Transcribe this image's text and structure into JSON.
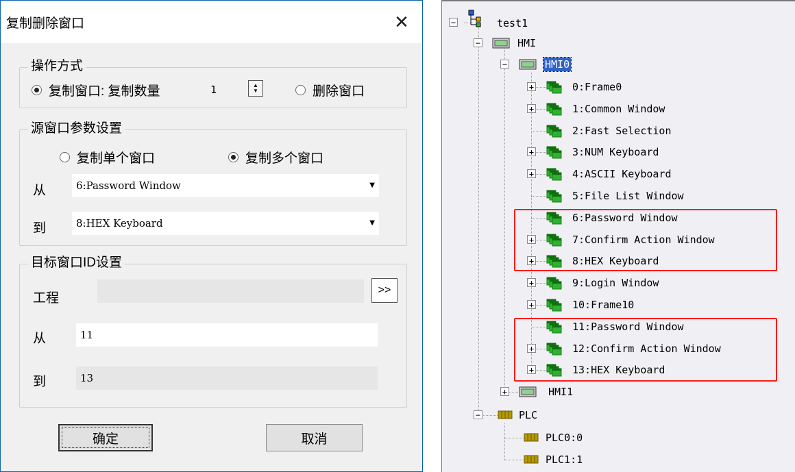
{
  "dialog": {
    "title": "复制删除窗口",
    "close_icon": "✕",
    "operation": {
      "legend": "操作方式",
      "copy_label": "复制窗口: 复制数量",
      "copy_selected": true,
      "count": "1",
      "delete_label": "删除窗口",
      "delete_selected": false
    },
    "source": {
      "legend": "源窗口参数设置",
      "single_label": "复制单个窗口",
      "multi_label": "复制多个窗口",
      "multi_selected": true,
      "from_label": "从",
      "from_value": "6:Password Window",
      "to_label": "到",
      "to_value": "8:HEX Keyboard"
    },
    "target": {
      "legend": "目标窗口ID设置",
      "project_label": "工程",
      "project_value": "",
      "browse_label": ">>",
      "from_label": "从",
      "from_value": "11",
      "to_label": "到",
      "to_value": "13"
    },
    "ok_label": "确定",
    "cancel_label": "取消"
  },
  "tree": {
    "root": "test1",
    "hmi": "HMI",
    "hmi0": "HMI0",
    "windows": [
      "0:Frame0",
      "1:Common Window",
      "2:Fast Selection",
      "3:NUM Keyboard",
      "4:ASCII Keyboard",
      "5:File List Window",
      "6:Password Window",
      "7:Confirm Action Window",
      "8:HEX Keyboard",
      "9:Login Window",
      "10:Frame10",
      "11:Password Window",
      "12:Confirm Action Window",
      "13:HEX Keyboard"
    ],
    "hmi1": "HMI1",
    "plc": "PLC",
    "plc0": "PLC0:0",
    "plc1": "PLC1:1",
    "colors": {
      "highlight": "#ff1a1a",
      "window_icon": "#2fb22f",
      "selected_bg": "#3162c4",
      "plc_icon": "#b59a00"
    }
  }
}
